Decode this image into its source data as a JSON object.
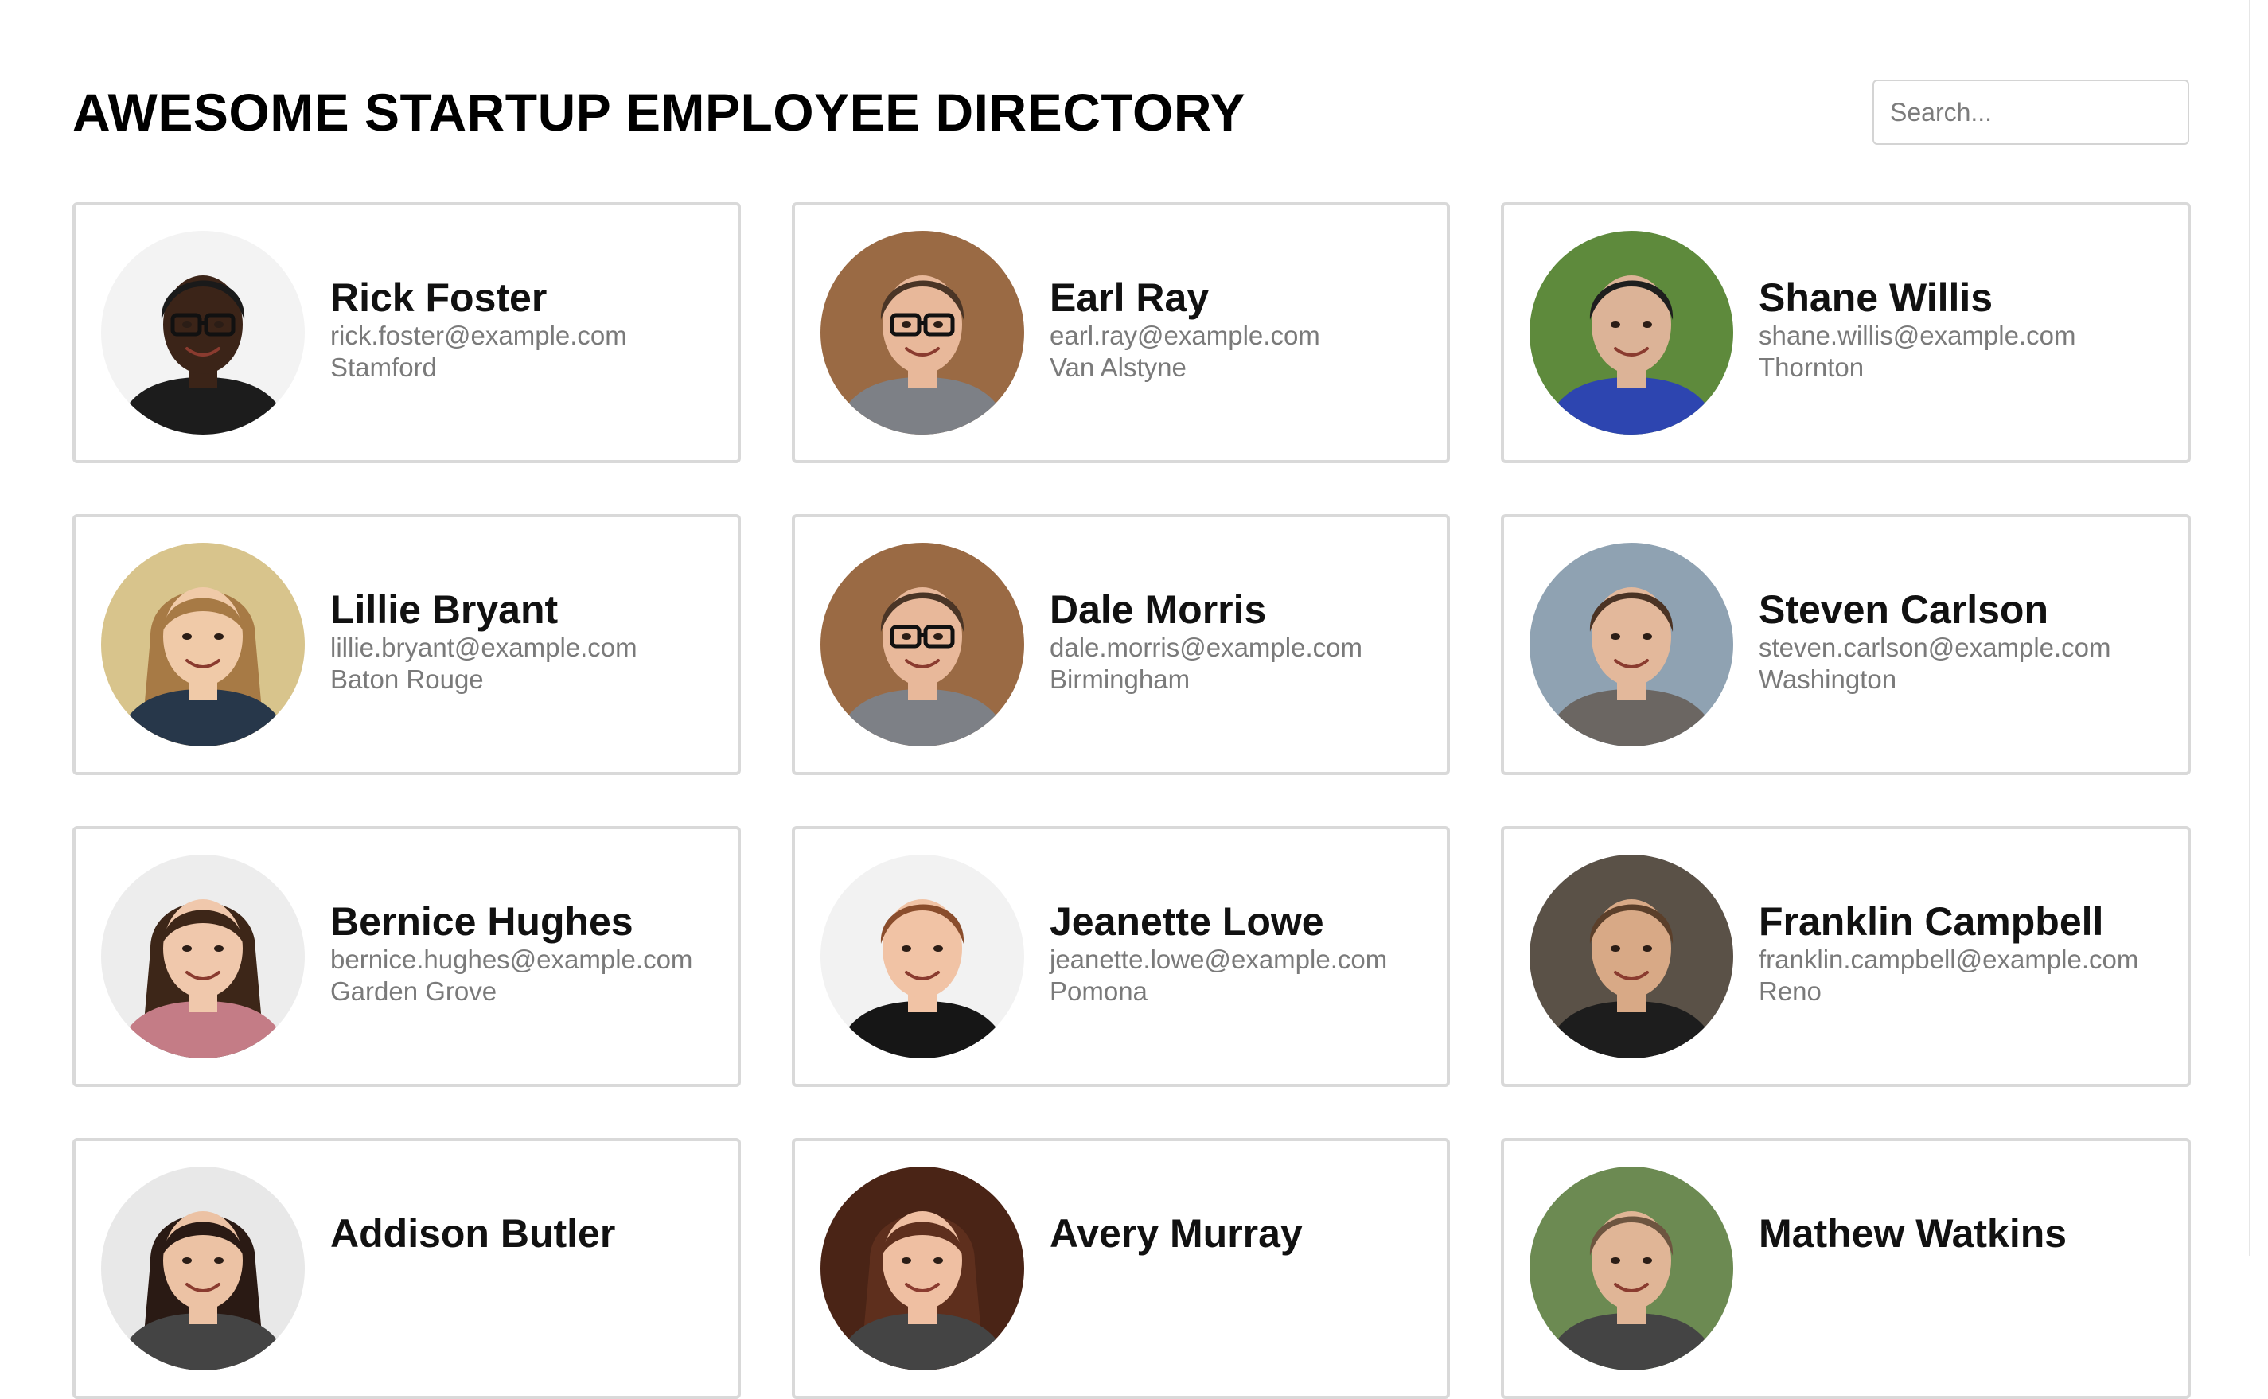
{
  "header": {
    "title": "AWESOME STARTUP EMPLOYEE DIRECTORY",
    "search_placeholder": "Search..."
  },
  "employees": [
    {
      "name": "Rick Foster",
      "email": "rick.foster@example.com",
      "city": "Stamford",
      "avatar": {
        "bg": "#f3f3f3",
        "skin": "#3b2418",
        "hair": "#1a1a1a",
        "shirt": "#1c1c1c",
        "hair_style": "short",
        "glasses": true
      }
    },
    {
      "name": "Earl Ray",
      "email": "earl.ray@example.com",
      "city": "Van Alstyne",
      "avatar": {
        "bg": "#9a6a44",
        "skin": "#e8b89a",
        "hair": "#4a3526",
        "shirt": "#7d8086",
        "hair_style": "short",
        "glasses": true
      }
    },
    {
      "name": "Shane Willis",
      "email": "shane.willis@example.com",
      "city": "Thornton",
      "avatar": {
        "bg": "#5e8a3c",
        "skin": "#dcb397",
        "hair": "#1e1e1e",
        "shirt": "#2d45b0",
        "hair_style": "short",
        "glasses": false
      }
    },
    {
      "name": "Lillie Bryant",
      "email": "lillie.bryant@example.com",
      "city": "Baton Rouge",
      "avatar": {
        "bg": "#d8c48c",
        "skin": "#f0caa8",
        "hair": "#a77a45",
        "shirt": "#27374a",
        "hair_style": "long",
        "glasses": false
      }
    },
    {
      "name": "Dale Morris",
      "email": "dale.morris@example.com",
      "city": "Birmingham",
      "avatar": {
        "bg": "#9a6a44",
        "skin": "#e8b89a",
        "hair": "#4a3526",
        "shirt": "#7d8086",
        "hair_style": "short",
        "glasses": true
      }
    },
    {
      "name": "Steven Carlson",
      "email": "steven.carlson@example.com",
      "city": "Washington",
      "avatar": {
        "bg": "#8fa2b2",
        "skin": "#e3b89b",
        "hair": "#4b3324",
        "shirt": "#6b6662",
        "hair_style": "short",
        "glasses": false
      }
    },
    {
      "name": "Bernice Hughes",
      "email": "bernice.hughes@example.com",
      "city": "Garden Grove",
      "avatar": {
        "bg": "#ededed",
        "skin": "#f0c8ac",
        "hair": "#3d2618",
        "shirt": "#c47c86",
        "hair_style": "long",
        "glasses": false
      }
    },
    {
      "name": "Jeanette Lowe",
      "email": "jeanette.lowe@example.com",
      "city": "Pomona",
      "avatar": {
        "bg": "#f2f2f2",
        "skin": "#f1c3a5",
        "hair": "#8a4d2c",
        "shirt": "#161616",
        "hair_style": "short",
        "glasses": false
      }
    },
    {
      "name": "Franklin Campbell",
      "email": "franklin.campbell@example.com",
      "city": "Reno",
      "avatar": {
        "bg": "#5a5147",
        "skin": "#d8a986",
        "hair": "#5b3f2a",
        "shirt": "#1d1d1d",
        "hair_style": "short",
        "glasses": false
      }
    },
    {
      "name": "Addison Butler",
      "email": "",
      "city": "",
      "avatar": {
        "bg": "#e8e8e8",
        "skin": "#ecc2a4",
        "hair": "#2a1a14",
        "shirt": "#444444",
        "hair_style": "long",
        "glasses": false
      }
    },
    {
      "name": "Avery Murray",
      "email": "",
      "city": "",
      "avatar": {
        "bg": "#4a2416",
        "skin": "#efbfa2",
        "hair": "#5e2f1d",
        "shirt": "#444444",
        "hair_style": "long",
        "glasses": false
      }
    },
    {
      "name": "Mathew Watkins",
      "email": "",
      "city": "",
      "avatar": {
        "bg": "#6c8a52",
        "skin": "#e0b596",
        "hair": "#6d5540",
        "shirt": "#444444",
        "hair_style": "short",
        "glasses": false
      }
    }
  ]
}
